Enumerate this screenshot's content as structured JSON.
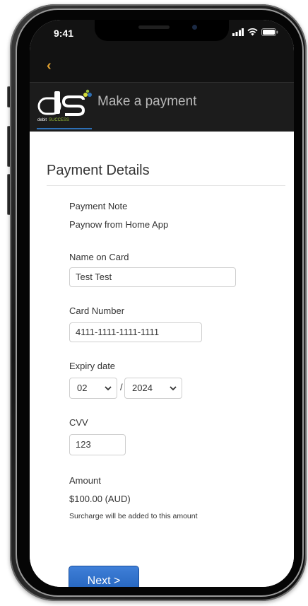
{
  "status_bar": {
    "time": "9:41",
    "icons": [
      "signal-icon",
      "wifi-icon",
      "battery-icon"
    ]
  },
  "nav": {
    "back_icon": "chevron-left-icon",
    "back_glyph": "‹"
  },
  "header": {
    "logo_main": "ds",
    "logo_sub_left": "debit",
    "logo_sub_right": "SUCCESS",
    "title": "Make a payment"
  },
  "payment": {
    "section_title": "Payment Details",
    "note_label": "Payment Note",
    "note_value": "Paynow from Home App",
    "name_label": "Name on Card",
    "name_value": "Test Test",
    "card_label": "Card Number",
    "card_value": "4111-1111-1111-1111",
    "expiry_label": "Expiry date",
    "expiry_month": "02",
    "expiry_separator": "/",
    "expiry_year": "2024",
    "cvv_label": "CVV",
    "cvv_value": "123",
    "amount_label": "Amount",
    "amount_value": "$100.00 (AUD)",
    "surcharge_note": "Surcharge will be added to this amount",
    "next_label": "Next >"
  },
  "colors": {
    "accent": "#e0a030",
    "primary_button": "#2a6cc8",
    "header_bg": "#1c1c1c",
    "logo_blue": "#2d6fb5"
  }
}
